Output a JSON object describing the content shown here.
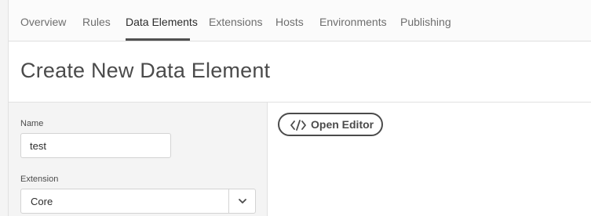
{
  "nav": {
    "tabs": [
      {
        "label": "Overview"
      },
      {
        "label": "Rules"
      },
      {
        "label": "Data Elements",
        "active": true
      },
      {
        "label": "Extensions"
      },
      {
        "label": "Hosts"
      },
      {
        "label": "Environments"
      },
      {
        "label": "Publishing"
      }
    ]
  },
  "header": {
    "title": "Create New Data Element"
  },
  "form": {
    "name_label": "Name",
    "name_value": "test",
    "extension_label": "Extension",
    "extension_value": "Core"
  },
  "editor": {
    "open_label": "Open Editor",
    "icon": "code-icon"
  },
  "icons": {
    "dropdown": "chevron-down-icon"
  }
}
